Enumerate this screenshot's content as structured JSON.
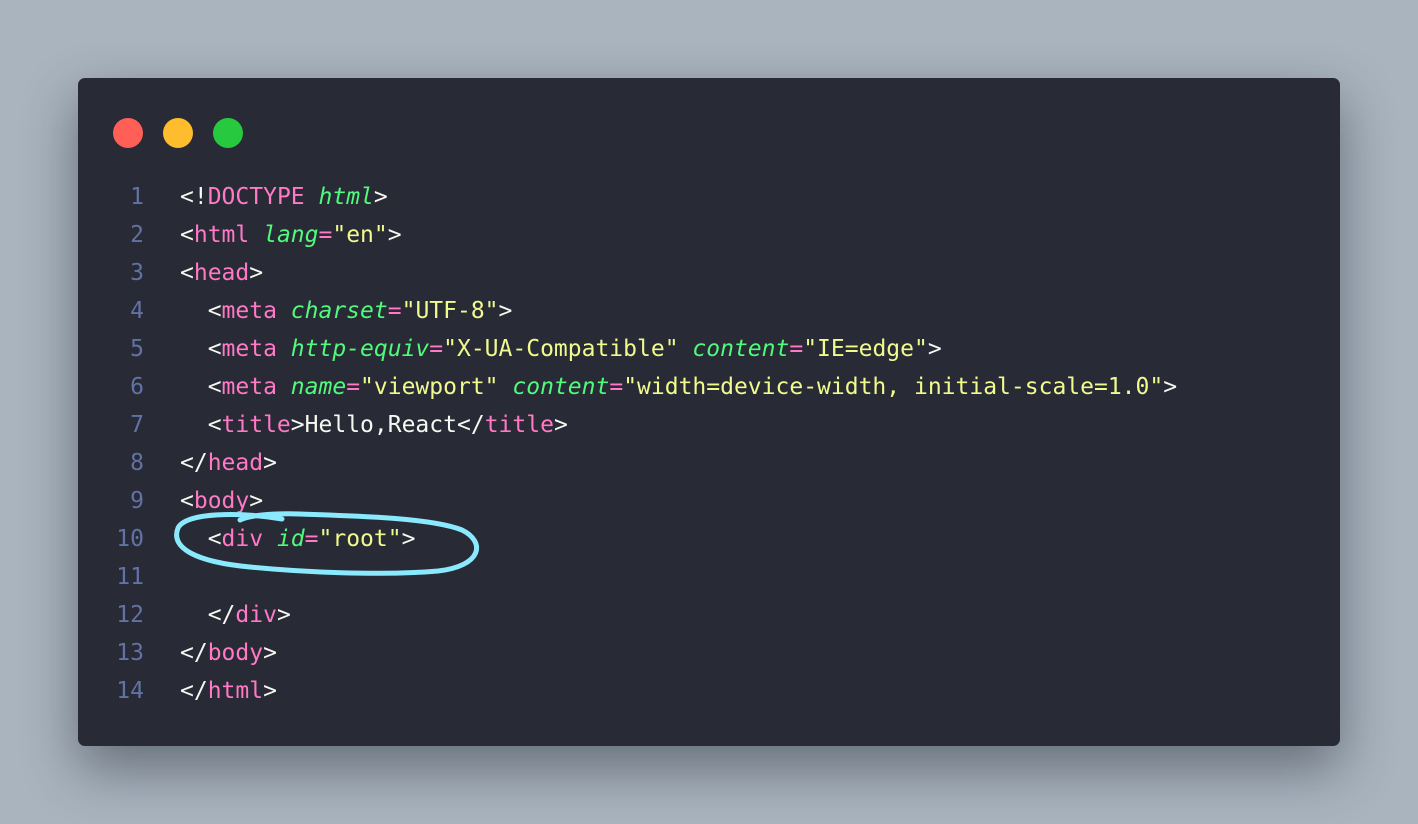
{
  "colors": {
    "page_background": "#a9b4bf",
    "editor_background": "#282a36",
    "line_number": "#6272a4",
    "punctuation": "#f8f8f2",
    "tag": "#ff79c6",
    "attribute": "#50fa7b",
    "string": "#f1fa8c",
    "text": "#f8f8f2",
    "annotation_stroke": "#8be9fd"
  },
  "window_controls": [
    {
      "name": "close-dot",
      "color": "#ff5f56"
    },
    {
      "name": "minimize-dot",
      "color": "#ffbd2e"
    },
    {
      "name": "maximize-dot",
      "color": "#27c93f"
    }
  ],
  "code": {
    "lines": [
      {
        "num": "1",
        "tokens": [
          [
            "p",
            "<!"
          ],
          [
            "t",
            "DOCTYPE"
          ],
          [
            "p",
            " "
          ],
          [
            "a",
            "html"
          ],
          [
            "p",
            ">"
          ]
        ]
      },
      {
        "num": "2",
        "tokens": [
          [
            "p",
            "<"
          ],
          [
            "t",
            "html"
          ],
          [
            "p",
            " "
          ],
          [
            "a",
            "lang"
          ],
          [
            "eq",
            "="
          ],
          [
            "s",
            "\"en\""
          ],
          [
            "p",
            ">"
          ]
        ]
      },
      {
        "num": "3",
        "tokens": [
          [
            "p",
            "<"
          ],
          [
            "t",
            "head"
          ],
          [
            "p",
            ">"
          ]
        ]
      },
      {
        "num": "4",
        "tokens": [
          [
            "p",
            "  <"
          ],
          [
            "t",
            "meta"
          ],
          [
            "p",
            " "
          ],
          [
            "a",
            "charset"
          ],
          [
            "eq",
            "="
          ],
          [
            "s",
            "\"UTF-8\""
          ],
          [
            "p",
            ">"
          ]
        ]
      },
      {
        "num": "5",
        "tokens": [
          [
            "p",
            "  <"
          ],
          [
            "t",
            "meta"
          ],
          [
            "p",
            " "
          ],
          [
            "a",
            "http-equiv"
          ],
          [
            "eq",
            "="
          ],
          [
            "s",
            "\"X-UA-Compatible\""
          ],
          [
            "p",
            " "
          ],
          [
            "a",
            "content"
          ],
          [
            "eq",
            "="
          ],
          [
            "s",
            "\"IE=edge\""
          ],
          [
            "p",
            ">"
          ]
        ]
      },
      {
        "num": "6",
        "tokens": [
          [
            "p",
            "  <"
          ],
          [
            "t",
            "meta"
          ],
          [
            "p",
            " "
          ],
          [
            "a",
            "name"
          ],
          [
            "eq",
            "="
          ],
          [
            "s",
            "\"viewport\""
          ],
          [
            "p",
            " "
          ],
          [
            "a",
            "content"
          ],
          [
            "eq",
            "="
          ],
          [
            "s",
            "\"width=device-width, initial-scale=1.0\""
          ],
          [
            "p",
            ">"
          ]
        ]
      },
      {
        "num": "7",
        "tokens": [
          [
            "p",
            "  <"
          ],
          [
            "t",
            "title"
          ],
          [
            "p",
            ">"
          ],
          [
            "tx",
            "Hello,React"
          ],
          [
            "p",
            "</"
          ],
          [
            "t",
            "title"
          ],
          [
            "p",
            ">"
          ]
        ]
      },
      {
        "num": "8",
        "tokens": [
          [
            "p",
            "</"
          ],
          [
            "t",
            "head"
          ],
          [
            "p",
            ">"
          ]
        ]
      },
      {
        "num": "9",
        "tokens": [
          [
            "p",
            "<"
          ],
          [
            "t",
            "body"
          ],
          [
            "p",
            ">"
          ]
        ]
      },
      {
        "num": "10",
        "tokens": [
          [
            "p",
            "  <"
          ],
          [
            "t",
            "div"
          ],
          [
            "p",
            " "
          ],
          [
            "a",
            "id"
          ],
          [
            "eq",
            "="
          ],
          [
            "s",
            "\"root\""
          ],
          [
            "p",
            ">"
          ]
        ]
      },
      {
        "num": "11",
        "tokens": []
      },
      {
        "num": "12",
        "tokens": [
          [
            "p",
            "  </"
          ],
          [
            "t",
            "div"
          ],
          [
            "p",
            ">"
          ]
        ]
      },
      {
        "num": "13",
        "tokens": [
          [
            "p",
            "</"
          ],
          [
            "t",
            "body"
          ],
          [
            "p",
            ">"
          ]
        ]
      },
      {
        "num": "14",
        "tokens": [
          [
            "p",
            "</"
          ],
          [
            "t",
            "html"
          ],
          [
            "p",
            ">"
          ]
        ]
      }
    ]
  }
}
